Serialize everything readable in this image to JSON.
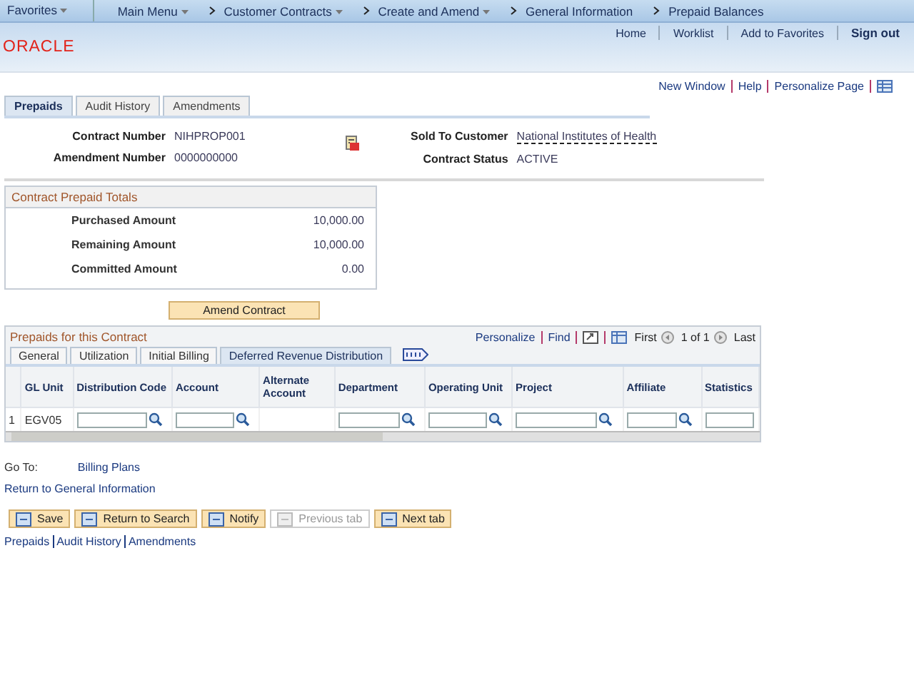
{
  "breadcrumb": {
    "favorites": "Favorites",
    "items": [
      "Main Menu",
      "Customer Contracts",
      "Create and Amend",
      "General Information",
      "Prepaid Balances"
    ]
  },
  "header_links": [
    "Home",
    "Worklist",
    "Add to Favorites",
    "Sign out"
  ],
  "logo": "ORACLE",
  "page_links": [
    "New Window",
    "Help",
    "Personalize Page"
  ],
  "page_tabs": [
    {
      "label": "Prepaids",
      "selected": true
    },
    {
      "label": "Audit History",
      "selected": false
    },
    {
      "label": "Amendments",
      "selected": false
    }
  ],
  "fields_left": [
    {
      "label": "Contract Number",
      "value": "NIHPROP001"
    },
    {
      "label": "Amendment Number",
      "value": "0000000000"
    }
  ],
  "fields_right": [
    {
      "label": "Sold To Customer",
      "value": "National Institutes of Health",
      "kind": "link"
    },
    {
      "label": "Contract Status",
      "value": "ACTIVE",
      "kind": "text"
    }
  ],
  "totals": {
    "title": "Contract Prepaid Totals",
    "rows": [
      {
        "label": "Purchased Amount",
        "value": "10,000.00"
      },
      {
        "label": "Remaining Amount",
        "value": "10,000.00"
      },
      {
        "label": "Committed Amount",
        "value": "0.00"
      }
    ]
  },
  "amend_button": "Amend Contract",
  "grid": {
    "title": "Prepaids for this Contract",
    "personalize": "Personalize",
    "find": "Find",
    "first": "First",
    "count": "1 of 1",
    "last": "Last",
    "tabs": [
      {
        "label": "General",
        "selected": false
      },
      {
        "label": "Utilization",
        "selected": false
      },
      {
        "label": "Initial Billing",
        "selected": false
      },
      {
        "label": "Deferred Revenue Distribution",
        "selected": true
      }
    ],
    "columns": [
      {
        "label": "GL Unit",
        "kind": "text"
      },
      {
        "label": "Distribution Code",
        "kind": "lookup"
      },
      {
        "label": "Account",
        "kind": "lookup"
      },
      {
        "label": "Alternate Account",
        "kind": "blank"
      },
      {
        "label": "Department",
        "kind": "lookup"
      },
      {
        "label": "Operating Unit",
        "kind": "lookup"
      },
      {
        "label": "Project",
        "kind": "lookup"
      },
      {
        "label": "Affiliate",
        "kind": "lookup"
      },
      {
        "label": "Statistics",
        "kind": "input"
      }
    ],
    "rows": [
      {
        "number": "1",
        "gl_unit": "EGV05"
      }
    ]
  },
  "goto": {
    "label": "Go To:",
    "link": "Billing Plans"
  },
  "return_link": "Return to General Information",
  "toolbar": [
    {
      "label": "Save",
      "disabled": false
    },
    {
      "label": "Return to Search",
      "disabled": false
    },
    {
      "label": "Notify",
      "disabled": false
    },
    {
      "label": "Previous tab",
      "disabled": true
    },
    {
      "label": "Next tab",
      "disabled": false
    }
  ],
  "footer_links": [
    "Prepaids",
    "Audit History",
    "Amendments"
  ]
}
